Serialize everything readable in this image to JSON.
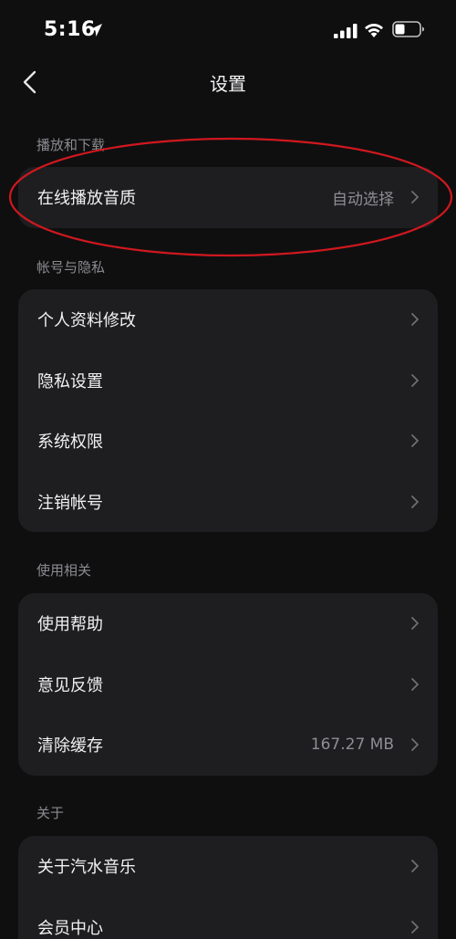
{
  "status_bar": {
    "time": "5:16",
    "icons": [
      "location-arrow-icon",
      "cellular-signal-icon",
      "wifi-icon",
      "battery-icon"
    ]
  },
  "nav": {
    "title": "设置",
    "back_icon": "chevron-left-icon"
  },
  "sections": {
    "playback": {
      "header": "播放和下载",
      "items": [
        {
          "label": "在线播放音质",
          "value": "自动选择"
        }
      ]
    },
    "account": {
      "header": "帐号与隐私",
      "items": [
        {
          "label": "个人资料修改"
        },
        {
          "label": "隐私设置"
        },
        {
          "label": "系统权限"
        },
        {
          "label": "注销帐号"
        }
      ]
    },
    "usage": {
      "header": "使用相关",
      "items": [
        {
          "label": "使用帮助"
        },
        {
          "label": "意见反馈"
        },
        {
          "label": "清除缓存",
          "value": "167.27 MB"
        }
      ]
    },
    "about": {
      "header": "关于",
      "items": [
        {
          "label": "关于汽水音乐"
        },
        {
          "label": "会员中心"
        }
      ]
    }
  },
  "colors": {
    "background": "#0f0f10",
    "card": "#1e1e20",
    "text_primary": "#f1f1f3",
    "text_secondary": "#8e8e93",
    "highlight_annotation": "#d0181e"
  }
}
